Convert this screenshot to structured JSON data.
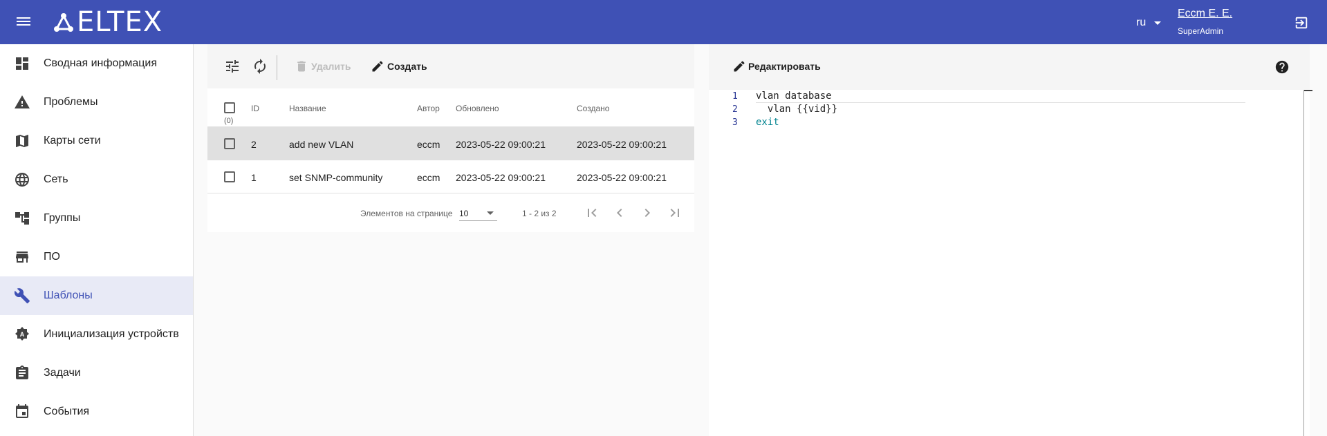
{
  "header": {
    "logo_text": "ELTEX",
    "language": "ru",
    "user_name": "Eccm E. E.",
    "user_role": "SuperAdmin"
  },
  "sidebar": {
    "items": [
      {
        "label": "Сводная информация",
        "icon": "dashboard-icon"
      },
      {
        "label": "Проблемы",
        "icon": "warning-icon"
      },
      {
        "label": "Карты сети",
        "icon": "map-icon"
      },
      {
        "label": "Сеть",
        "icon": "globe-icon"
      },
      {
        "label": "Группы",
        "icon": "hierarchy-icon"
      },
      {
        "label": "ПО",
        "icon": "store-icon"
      },
      {
        "label": "Шаблоны",
        "icon": "wrench-icon",
        "active": true
      },
      {
        "label": "Инициализация устройств",
        "icon": "auto-badge-icon"
      },
      {
        "label": "Задачи",
        "icon": "clipboard-icon"
      },
      {
        "label": "События",
        "icon": "calendar-icon"
      }
    ]
  },
  "toolbar": {
    "delete_label": "Удалить",
    "create_label": "Создать"
  },
  "table": {
    "columns": [
      "ID",
      "Название",
      "Автор",
      "Обновлено",
      "Создано"
    ],
    "selected_count": "(0)",
    "rows": [
      {
        "id": "2",
        "name": "add new VLAN",
        "author": "eccm",
        "updated": "2023-05-22 09:00:21",
        "created": "2023-05-22 09:00:21",
        "selected": true
      },
      {
        "id": "1",
        "name": "set SNMP-community",
        "author": "eccm",
        "updated": "2023-05-22 09:00:21",
        "created": "2023-05-22 09:00:21",
        "selected": false
      }
    ]
  },
  "pager": {
    "items_per_page_label": "Элементов на странице",
    "items_per_page_value": "10",
    "range": "1 - 2 из 2"
  },
  "editor": {
    "edit_label": "Редактировать",
    "lines": [
      {
        "num": "1",
        "text": "vlan database"
      },
      {
        "num": "2",
        "text": "  vlan {{vid}}"
      },
      {
        "num": "3",
        "text": "exit"
      }
    ]
  },
  "colors": {
    "primary": "#3f51b5",
    "active_nav_bg": "#e8eaf6",
    "selected_row_bg": "#e0e0e0",
    "keyword": "#00838f"
  }
}
